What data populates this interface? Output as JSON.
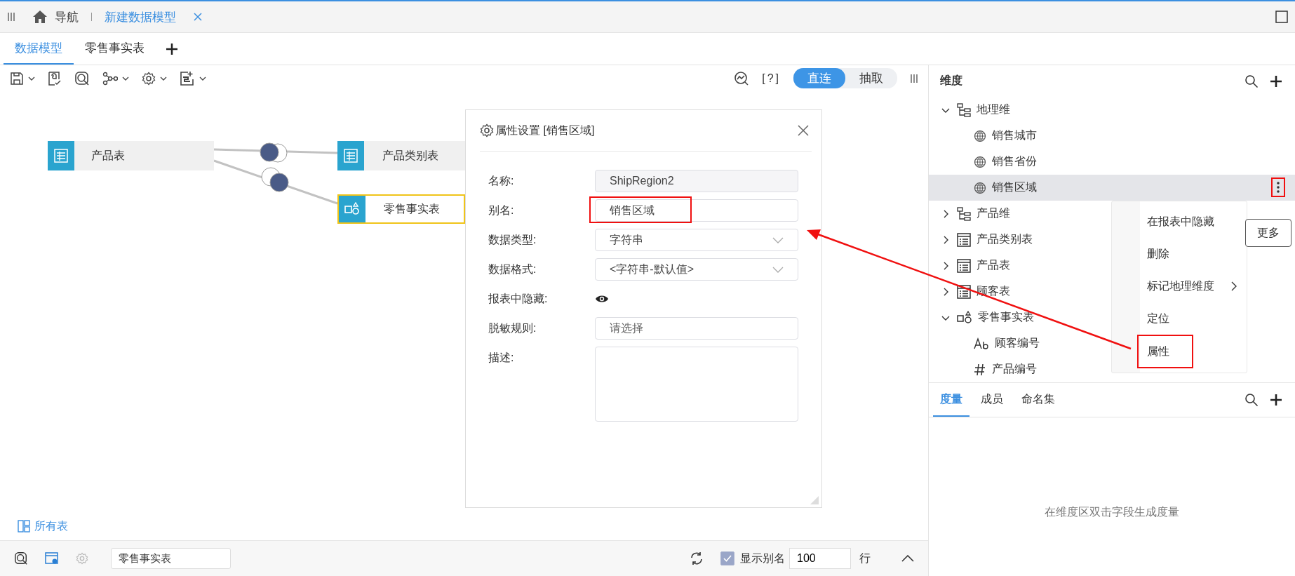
{
  "top_bar": {
    "nav": {
      "label": "导航"
    },
    "open_tabs": [
      {
        "label": "新建数据模型",
        "selected": true
      }
    ]
  },
  "tabs": [
    {
      "label": "数据模型",
      "selected": true
    },
    {
      "label": "零售事实表",
      "selected": false
    }
  ],
  "toolbar": {
    "help": "[?]",
    "modes": [
      {
        "label": "直连",
        "selected": true
      },
      {
        "label": "抽取",
        "selected": false
      }
    ]
  },
  "canvas": {
    "nodes": [
      {
        "label": "产品表",
        "kind": "table",
        "selected": false
      },
      {
        "label": "产品类别表",
        "kind": "table",
        "selected": false
      },
      {
        "label": "零售事实表",
        "kind": "fact",
        "selected": true
      }
    ],
    "all_tables_link": "所有表"
  },
  "bottom_bar": {
    "table_name": "零售事实表",
    "show_alias": {
      "label": "显示别名",
      "checked": true
    },
    "row_count": "100",
    "row_unit": "行"
  },
  "dimensions": {
    "title": "维度",
    "tree": [
      {
        "label": "地理维",
        "kind": "hierarchy",
        "expanded": true,
        "selected": false,
        "children": [
          {
            "label": "销售城市",
            "kind": "geo",
            "selected": false
          },
          {
            "label": "销售省份",
            "kind": "geo",
            "selected": false
          },
          {
            "label": "销售区域",
            "kind": "geo",
            "selected": true,
            "annotated": true
          }
        ]
      },
      {
        "label": "产品维",
        "kind": "hierarchy",
        "expanded": false,
        "selected": false
      },
      {
        "label": "产品类别表",
        "kind": "table",
        "expanded": false,
        "selected": false
      },
      {
        "label": "产品表",
        "kind": "table",
        "expanded": false,
        "selected": false
      },
      {
        "label": "顾客表",
        "kind": "table",
        "expanded": false,
        "selected": false
      },
      {
        "label": "零售事实表",
        "kind": "fact",
        "expanded": true,
        "selected": false,
        "children": [
          {
            "label": "顾客编号",
            "kind": "text",
            "selected": false
          },
          {
            "label": "产品编号",
            "kind": "number",
            "selected": false
          }
        ]
      }
    ]
  },
  "context_menu": {
    "items": [
      {
        "label": "在报表中隐藏",
        "submenu": false,
        "annotated": false
      },
      {
        "label": "删除",
        "submenu": false,
        "annotated": false
      },
      {
        "label": "标记地理维度",
        "submenu": true,
        "annotated": false
      },
      {
        "label": "定位",
        "submenu": false,
        "annotated": false
      },
      {
        "label": "属性",
        "submenu": false,
        "annotated": true
      }
    ],
    "tooltip": "更多"
  },
  "measures": {
    "tabs": [
      {
        "label": "度量",
        "selected": true
      },
      {
        "label": "成员",
        "selected": false
      },
      {
        "label": "命名集",
        "selected": false
      }
    ],
    "empty_message": "在维度区双击字段生成度量"
  },
  "dialog": {
    "title": "属性设置 [销售区域]",
    "fields": [
      {
        "label": "名称:",
        "kind": "readonly",
        "value": "ShipRegion2"
      },
      {
        "label": "别名:",
        "kind": "text",
        "value": "销售区域",
        "annotated": true
      },
      {
        "label": "数据类型:",
        "kind": "select",
        "value": "字符串"
      },
      {
        "label": "数据格式:",
        "kind": "select",
        "value": "<字符串-默认值>"
      },
      {
        "label": "报表中隐藏:",
        "kind": "toggle",
        "hidden": false
      },
      {
        "label": "脱敏规则:",
        "kind": "select",
        "placeholder": "请选择"
      },
      {
        "label": "描述:",
        "kind": "textarea"
      }
    ]
  }
}
